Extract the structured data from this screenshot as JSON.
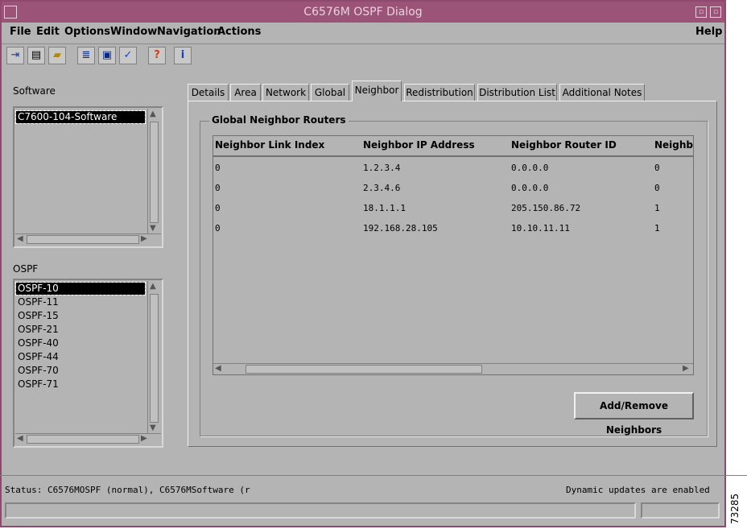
{
  "window": {
    "title": "C6576M OSPF Dialog"
  },
  "menubar": {
    "file": "File",
    "edit": "Edit",
    "options": "Options",
    "window": "Window",
    "navigation": "Navigation",
    "actions": "Actions",
    "help": "Help"
  },
  "toolbar": {
    "icons": [
      "exit-icon",
      "print-icon",
      "open-folder-icon",
      "list-icon",
      "monitor-icon",
      "checkmark-icon",
      "help-icon",
      "info-icon"
    ]
  },
  "software": {
    "label": "Software",
    "items": [
      "C7600-104-Software"
    ],
    "selected": 0
  },
  "ospf": {
    "label": "OSPF",
    "items": [
      "OSPF-10",
      "OSPF-11",
      "OSPF-15",
      "OSPF-21",
      "OSPF-40",
      "OSPF-44",
      "OSPF-70",
      "OSPF-71"
    ],
    "selected": 0
  },
  "tabs": [
    "Details",
    "Area",
    "Network",
    "Global",
    "Neighbor",
    "Redistribution",
    "Distribution List",
    "Additional Notes"
  ],
  "active_tab": "Neighbor",
  "group": {
    "title": "Global Neighbor Routers"
  },
  "table": {
    "columns": [
      "Neighbor Link Index",
      "Neighbor IP Address",
      "Neighbor Router ID",
      "Neighbo"
    ],
    "rows": [
      [
        "0",
        "1.2.3.4",
        "0.0.0.0",
        "0"
      ],
      [
        "0",
        "2.3.4.6",
        "0.0.0.0",
        "0"
      ],
      [
        "0",
        "18.1.1.1",
        "205.150.86.72",
        "1"
      ],
      [
        "0",
        "192.168.28.105",
        "10.10.11.11",
        "1"
      ]
    ]
  },
  "buttons": {
    "add_remove": "Add/Remove Neighbors"
  },
  "status": {
    "left": "Status: C6576MOSPF (normal), C6576MSoftware (r",
    "right": "Dynamic updates are enabled"
  },
  "figure_number": "73285",
  "colors": {
    "titlebar": "#9c5378",
    "background": "#b4b4b4",
    "selection": "#000000"
  }
}
